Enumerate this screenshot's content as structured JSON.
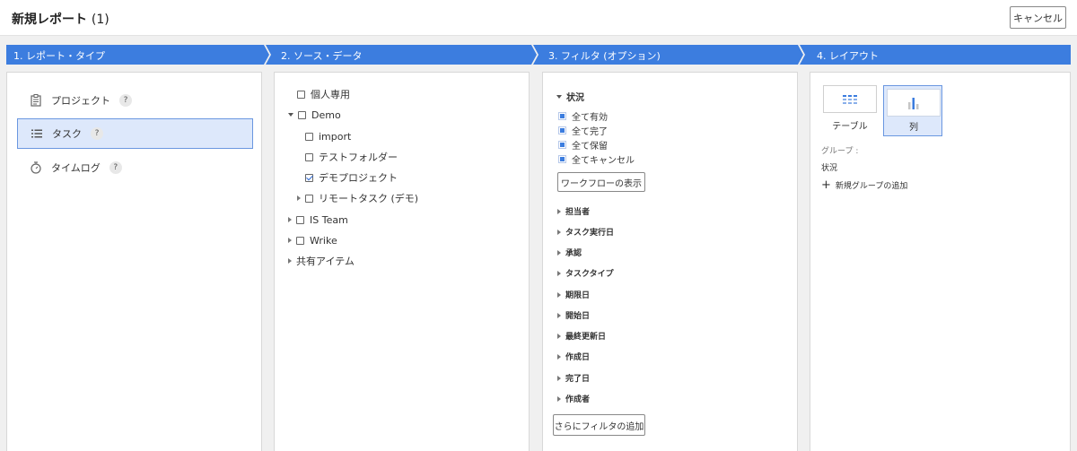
{
  "header": {
    "title": "新規レポート",
    "count": "(1)",
    "cancel_label": "キャンセル"
  },
  "steps": [
    {
      "label": "1. レポート・タイプ"
    },
    {
      "label": "2. ソース・データ"
    },
    {
      "label": "3. フィルタ (オプション)"
    },
    {
      "label": "4. レイアウト"
    }
  ],
  "report_types": [
    {
      "label": "プロジェクト",
      "icon": "clipboard-icon",
      "help": "?"
    },
    {
      "label": "タスク",
      "icon": "list-icon",
      "help": "?",
      "selected": true
    },
    {
      "label": "タイムログ",
      "icon": "stopwatch-icon",
      "help": "?"
    }
  ],
  "source_tree": [
    {
      "label": "個人専用"
    },
    {
      "label": "Demo"
    },
    {
      "label": "import"
    },
    {
      "label": "テストフォルダー"
    },
    {
      "label": "デモプロジェクト",
      "checked": true
    },
    {
      "label": "リモートタスク (デモ)"
    },
    {
      "label": "IS Team"
    },
    {
      "label": "Wrike"
    },
    {
      "label": "共有アイテム"
    }
  ],
  "filters": {
    "status_title": "状況",
    "status_options": [
      "全て有効",
      "全て完了",
      "全て保留",
      "全てキャンセル"
    ],
    "workflow_button": "ワークフローの表示",
    "filter_items": [
      "担当者",
      "タスク実行日",
      "承認",
      "タスクタイプ",
      "期限日",
      "開始日",
      "最終更新日",
      "作成日",
      "完了日",
      "作成者"
    ],
    "add_filter_button": "さらにフィルタの追加"
  },
  "layout": {
    "options": [
      {
        "label": "テーブル",
        "icon": "table-icon"
      },
      {
        "label": "列",
        "icon": "bar-chart-icon",
        "selected": true
      }
    ],
    "group_label": "グループ :",
    "group_value": "状況",
    "add_group_label": "新規グループの追加"
  },
  "colors": {
    "accent": "#3c7ddf",
    "selected_bg": "#dde8fb",
    "selected_border": "#6a97e0"
  }
}
